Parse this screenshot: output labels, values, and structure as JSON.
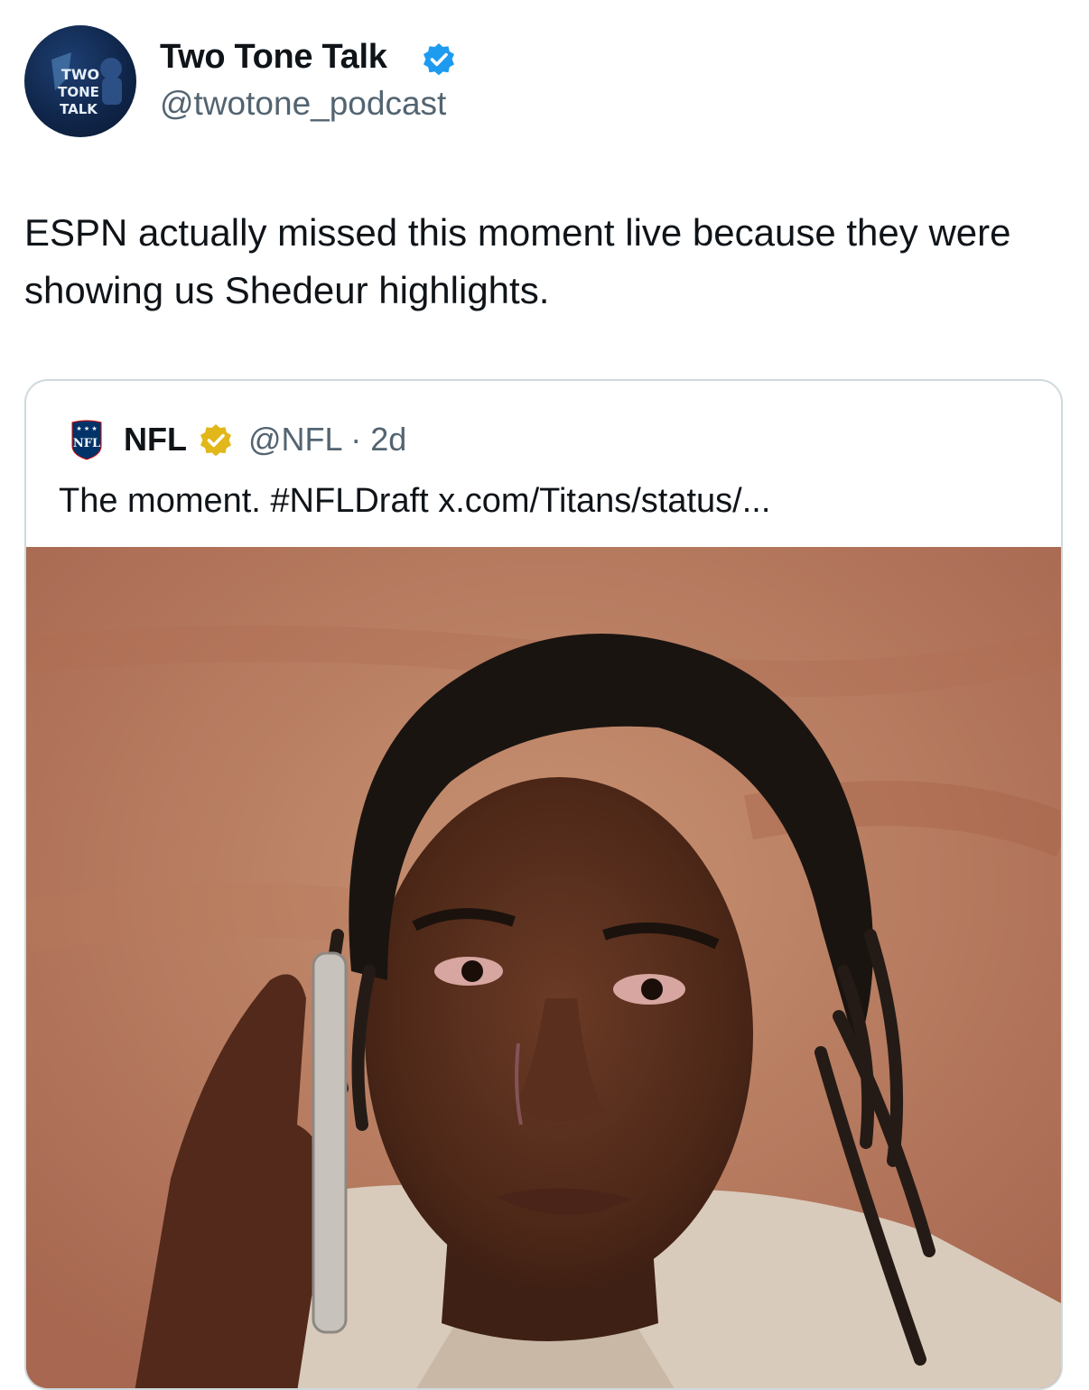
{
  "author": {
    "display_name": "Two Tone Talk",
    "handle": "@twotone_podcast",
    "avatar_text": [
      "TWO",
      "TONE",
      "TALK"
    ],
    "verified": true,
    "verified_color": "#1d9bf0"
  },
  "tweet": {
    "text": "ESPN actually missed this moment live because they were showing us Shedeur highlights."
  },
  "quoted_tweet": {
    "display_name": "NFL",
    "handle_time": "@NFL · 2d",
    "logo_text": "NFL",
    "verified": true,
    "verified_color": "#e2b719",
    "text": "The moment. #NFLDraft x.com/Titans/status/..."
  },
  "colors": {
    "text_primary": "#0f1419",
    "text_secondary": "#536471",
    "border": "#cfd9de"
  }
}
